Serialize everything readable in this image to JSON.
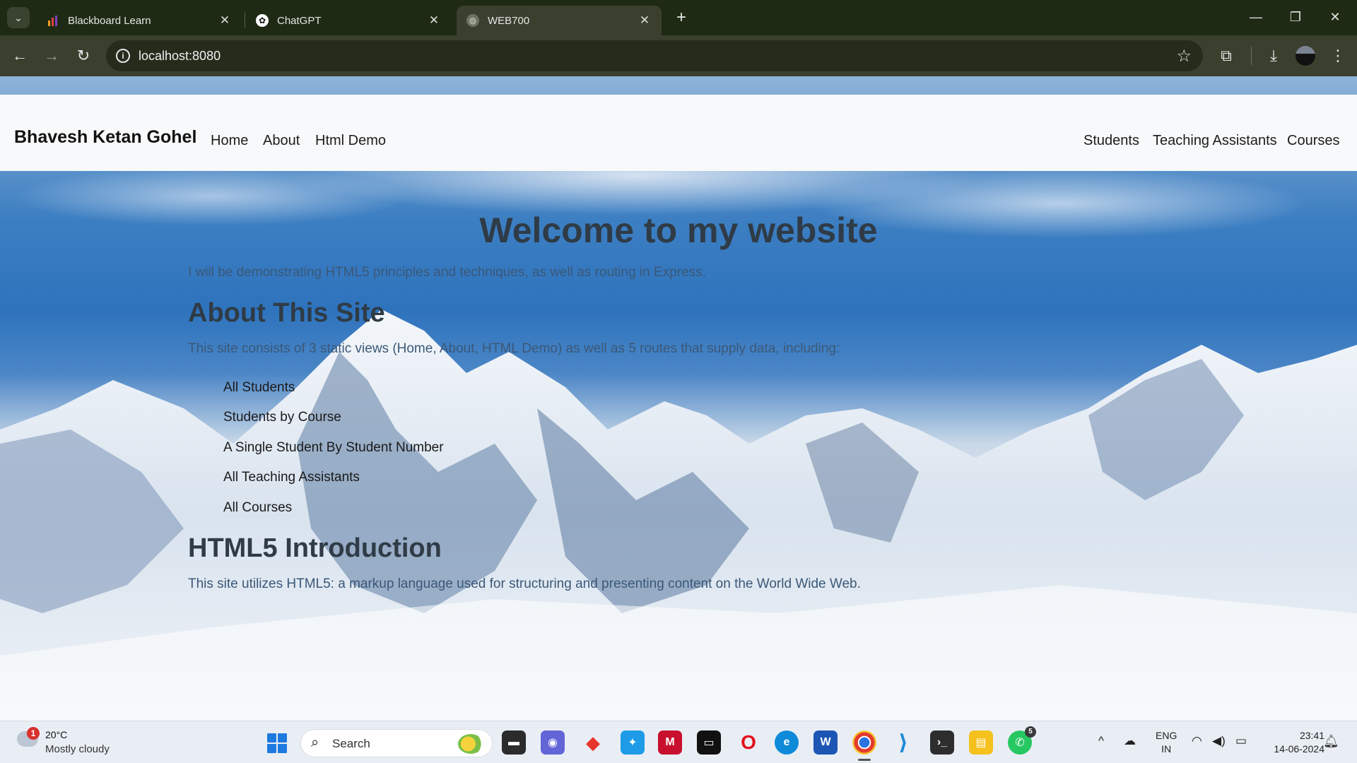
{
  "browser": {
    "tabs": [
      {
        "title": "Blackboard Learn",
        "favicon": "chart-bars-icon",
        "active": false
      },
      {
        "title": "ChatGPT",
        "favicon": "openai-icon",
        "active": false
      },
      {
        "title": "WEB700",
        "favicon": "globe-icon",
        "active": true
      }
    ],
    "address": "localhost:8080"
  },
  "site": {
    "brand": "Bhavesh Ketan Gohel",
    "nav_left": [
      "Home",
      "About",
      "Html Demo"
    ],
    "nav_right": [
      "Students",
      "Teaching Assistants",
      "Courses"
    ],
    "welcome_title": "Welcome to my website",
    "intro": "I will be demonstrating HTML5 principles and techniques, as well as routing in Express.",
    "about_title": "About This Site",
    "about_text": "This site consists of 3 static views (Home, About, HTML Demo) as well as 5 routes that supply data, including:",
    "routes": [
      "All Students",
      "Students by Course",
      "A Single Student By Student Number",
      "All Teaching Assistants",
      "All Courses"
    ],
    "html5_title": "HTML5 Introduction",
    "html5_text": "This site utilizes HTML5: a markup language used for structuring and presenting content on the World Wide Web."
  },
  "taskbar": {
    "weather_temp": "20°C",
    "weather_desc": "Mostly cloudy",
    "weather_badge": "1",
    "search_label": "Search",
    "whatsapp_badge": "5",
    "lang_line1": "ENG",
    "lang_line2": "IN",
    "time": "23:41",
    "date": "14-06-2024"
  }
}
